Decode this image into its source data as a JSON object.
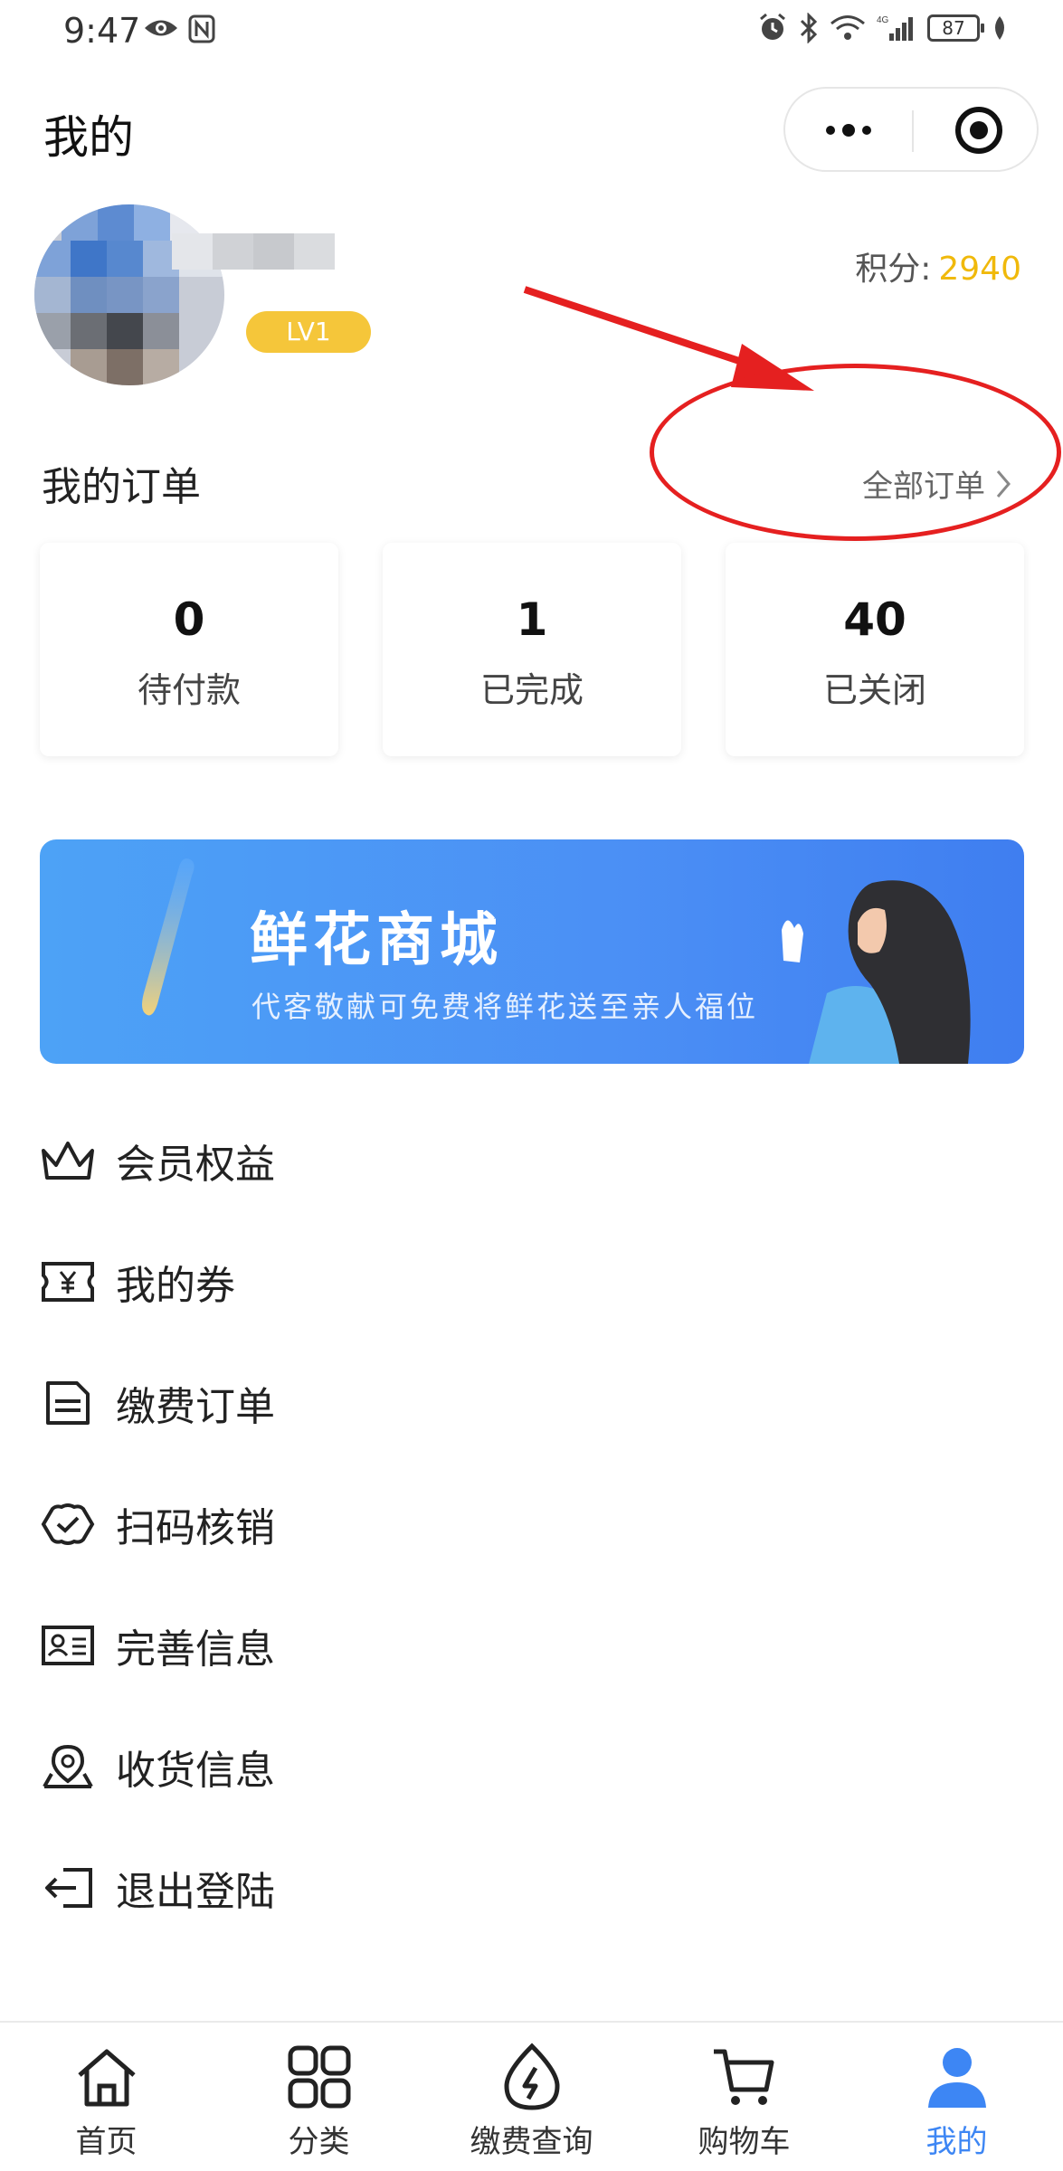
{
  "status_bar": {
    "time": "9:47",
    "battery": "87",
    "network": "4G"
  },
  "header": {
    "title": "我的",
    "more_icon": "more-dots-icon",
    "target_icon": "target-icon"
  },
  "profile": {
    "level": "LV1",
    "points_label": "积分:",
    "points_value": "2940",
    "accent_color": "#f0b90b"
  },
  "orders": {
    "title": "我的订单",
    "all_orders_label": "全部订单",
    "cards": [
      {
        "count": "0",
        "label": "待付款"
      },
      {
        "count": "1",
        "label": "已完成"
      },
      {
        "count": "40",
        "label": "已关闭"
      }
    ]
  },
  "banner": {
    "title": "鲜花商城",
    "subtitle": "代客敬献可免费将鲜花送至亲人福位"
  },
  "menu": {
    "items": [
      {
        "label": "会员权益",
        "icon": "crown-icon"
      },
      {
        "label": "我的券",
        "icon": "coupon-icon"
      },
      {
        "label": "缴费订单",
        "icon": "document-icon"
      },
      {
        "label": "扫码核销",
        "icon": "scan-verify-icon"
      },
      {
        "label": "完善信息",
        "icon": "id-card-icon"
      },
      {
        "label": "收货信息",
        "icon": "location-icon"
      },
      {
        "label": "退出登陆",
        "icon": "logout-icon"
      }
    ]
  },
  "tabbar": {
    "active_color": "#3d86f4",
    "tabs": [
      {
        "label": "首页",
        "icon": "home-icon"
      },
      {
        "label": "分类",
        "icon": "grid-icon"
      },
      {
        "label": "缴费查询",
        "icon": "lightning-drop-icon"
      },
      {
        "label": "购物车",
        "icon": "cart-icon"
      },
      {
        "label": "我的",
        "icon": "user-icon",
        "active": true
      }
    ]
  }
}
